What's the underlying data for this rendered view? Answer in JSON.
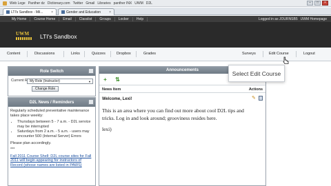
{
  "browser": {
    "bookmarks": [
      "Web Lege",
      "Panther dz",
      "Dictionary.com",
      "Twitter",
      "Gmail",
      "Libraries",
      "panther INX",
      "UWM",
      "D2L"
    ],
    "tabs": [
      {
        "label": "LTI's Sandbox - Mil...",
        "close": "×"
      },
      {
        "label": "Gender and Education",
        "close": "×"
      }
    ],
    "window_controls": [
      "–",
      "□",
      "×"
    ]
  },
  "site_nav": {
    "items": [
      "My Home",
      "Course Home",
      "Email",
      "Classlist",
      "Groups",
      "Locker",
      "Help"
    ],
    "logged_in": "Logged in as JOURNSB5",
    "home_link": "UWM Homepage"
  },
  "header": {
    "logo_text": "UWM",
    "course_title": "LTI's Sandbox"
  },
  "course_nav": {
    "items": [
      "Content",
      "Discussions",
      "Links",
      "Quizzes",
      "Dropbox",
      "Grades",
      "Surveys",
      "Edit Course",
      "Logout"
    ]
  },
  "tooltip": {
    "text": "Select Edit Course"
  },
  "role_switch": {
    "title": "Role Switch",
    "current_label": "Current Role:",
    "selected_role": "My Role (Instructor)",
    "button": "Change Role"
  },
  "news_widget": {
    "title": "D2L News / Reminders",
    "intro": "Regularly scheduled preventative maintenance takes place weekly:",
    "items": [
      "Thursdays between 5 - 7 a.m. - D2L service may be interrupted",
      "Saturdays from 2 a.m. - 5 a.m. - users may encounter 500 (Internal Server) Errors"
    ],
    "note": "Please plan accordingly.",
    "divider": "***",
    "footer": "Fall 2011 Course Shell: D2L course sites for Fall 2011 will begin appearing for instructors of Record (whose names are listed in PAWS)"
  },
  "announcements": {
    "title": "Announcements",
    "col_item": "News Item",
    "col_actions": "Actions",
    "item_title": "Welcome, Lexi!",
    "item_body": "This is an area where you can find out more about cool D2L tips and tricks. Log in and look around; grooviness resides here.",
    "signature": "lexi)"
  },
  "colors": {
    "header_bg": "#2a2a2a",
    "widget_head": "#7f8993",
    "accent_gold": "#e9c33a"
  }
}
